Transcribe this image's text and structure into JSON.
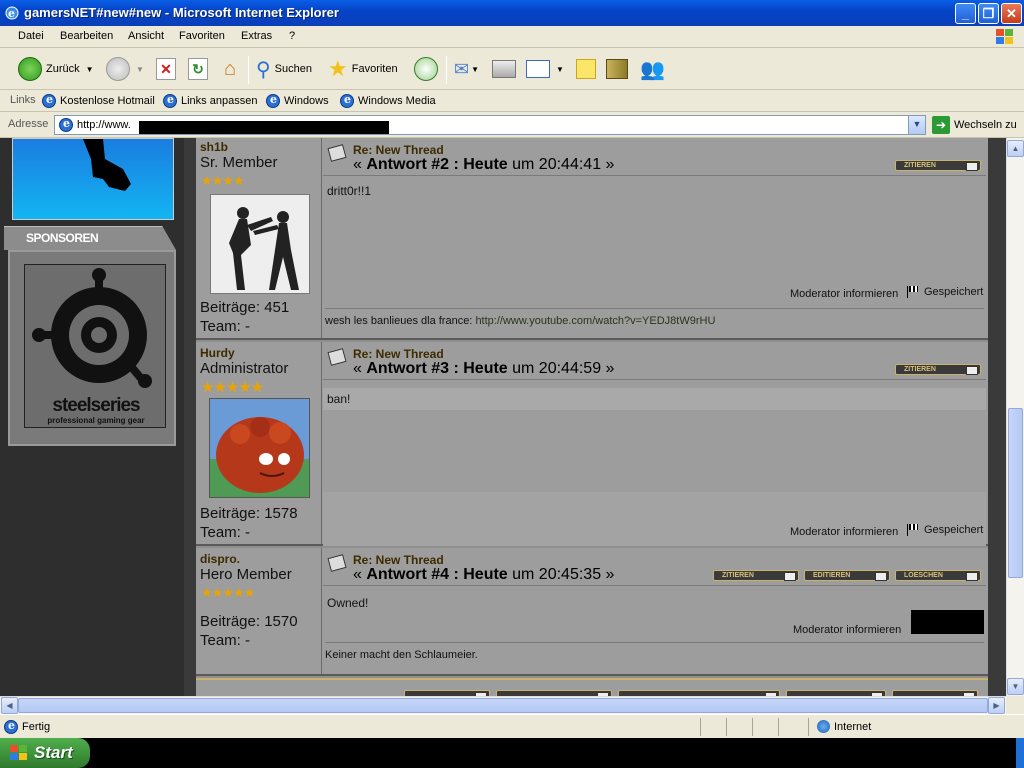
{
  "window": {
    "title": "gamersNET#new#new - Microsoft Internet Explorer"
  },
  "menu": [
    "Datei",
    "Bearbeiten",
    "Ansicht",
    "Favoriten",
    "Extras",
    "?"
  ],
  "toolbar": {
    "back": "Zurück",
    "search": "Suchen",
    "favorites": "Favoriten"
  },
  "links": {
    "label": "Links",
    "items": [
      "Kostenlose Hotmail",
      "Links anpassen",
      "Windows",
      "Windows Media"
    ]
  },
  "address": {
    "label": "Adresse",
    "url": "http://www.",
    "go": "Wechseln zu"
  },
  "sidebar": {
    "sponsors_title": "SPONSOREN",
    "brand": "steelseries",
    "brand_sub": "professional gaming gear"
  },
  "posts": [
    {
      "user": "sh1b",
      "rank": "Sr. Member",
      "stars": "★★★★",
      "posts_label": "Beiträge: 451",
      "team_label": "Team: -",
      "thread": "Re: New Thread",
      "answer_prefix": "« ",
      "answer": "Antwort #2 : Heute",
      "time": " um 20:44:41 »",
      "body": "dritt0r!!1",
      "mod": "Moderator informieren",
      "saved": "Gespeichert",
      "signature_text": "wesh les banlieues dla france: ",
      "signature_url": "http://www.youtube.com/watch?v=YEDJ8tW9rHU",
      "buttons": [
        "ZITIEREN"
      ]
    },
    {
      "user": "Hurdy",
      "rank": "Administrator",
      "stars": "★★★★★",
      "posts_label": "Beiträge: 1578",
      "team_label": "Team: -",
      "thread": "Re: New Thread",
      "answer_prefix": "« ",
      "answer": "Antwort #3 : Heute",
      "time": " um 20:44:59 »",
      "body": "ban!",
      "mod": "Moderator informieren",
      "saved": "Gespeichert",
      "buttons": [
        "ZITIEREN"
      ]
    },
    {
      "user": "dispro.",
      "rank": "Hero Member",
      "stars": "★★★★★",
      "posts_label": "Beiträge: 1570",
      "team_label": "Team: -",
      "thread": "Re: New Thread",
      "answer_prefix": "« ",
      "answer": "Antwort #4 : Heute",
      "time": " um 20:45:35 »",
      "body": "Owned!",
      "mod": "Moderator informieren",
      "signature_text": "Keiner macht den Schlaumeier.",
      "buttons": [
        "ZITIEREN",
        "EDITIEREN",
        "LOESCHEN"
      ]
    }
  ],
  "status": {
    "text": "Fertig",
    "zone": "Internet"
  },
  "taskbar": {
    "start": "Start"
  }
}
